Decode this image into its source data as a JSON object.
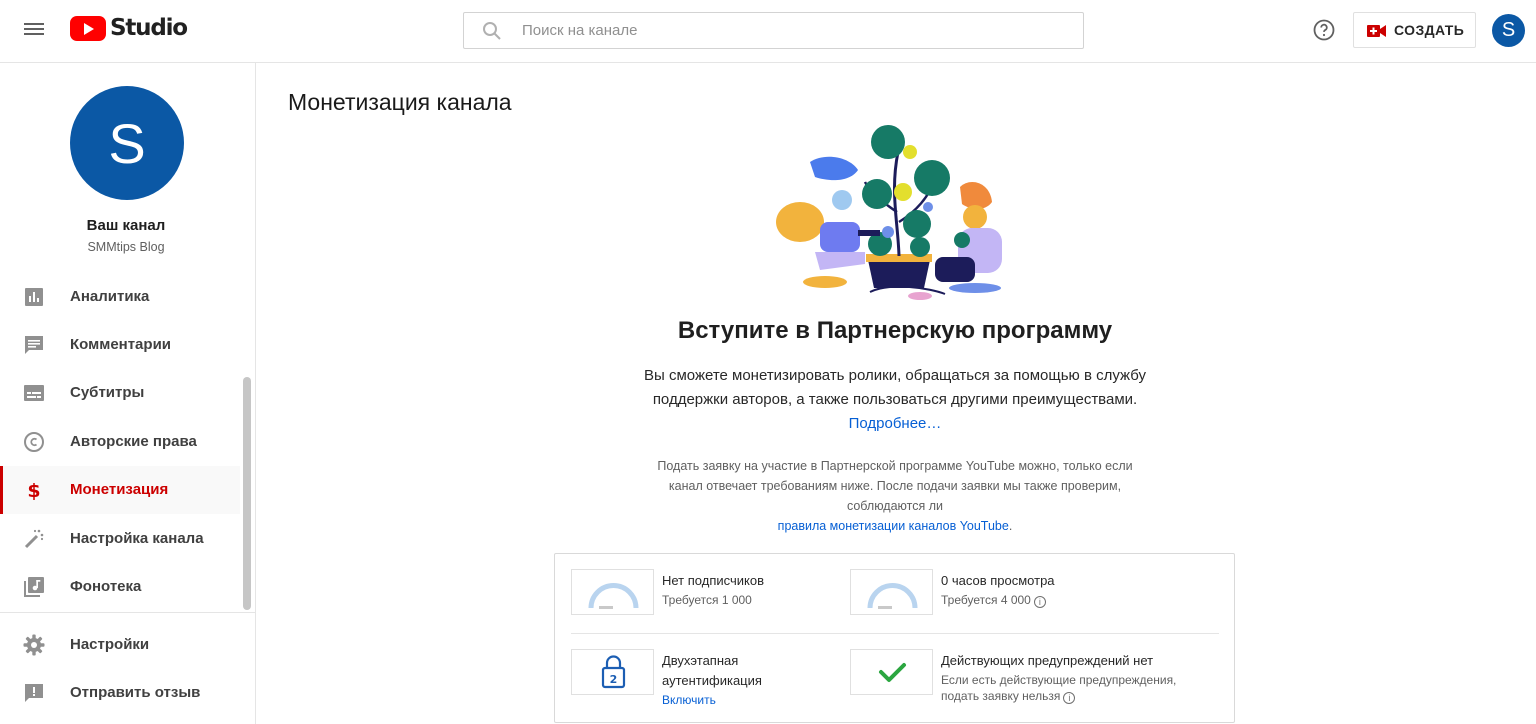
{
  "header": {
    "logo_text": "Studio",
    "search_placeholder": "Поиск на канале",
    "create_label": "СОЗДАТЬ",
    "avatar_letter": "S"
  },
  "sidebar": {
    "avatar_letter": "S",
    "channel_title": "Ваш канал",
    "channel_name": "SMMtips Blog",
    "items": [
      {
        "label": "Аналитика",
        "icon": "analytics-icon"
      },
      {
        "label": "Комментарии",
        "icon": "comments-icon"
      },
      {
        "label": "Субтитры",
        "icon": "subtitles-icon"
      },
      {
        "label": "Авторские права",
        "icon": "copyright-icon"
      },
      {
        "label": "Монетизация",
        "icon": "dollar-icon",
        "active": true
      },
      {
        "label": "Настройка канала",
        "icon": "magic-wand-icon"
      },
      {
        "label": "Фонотека",
        "icon": "music-library-icon"
      },
      {
        "label": "Настройки",
        "icon": "gear-icon"
      },
      {
        "label": "Отправить отзыв",
        "icon": "feedback-icon"
      }
    ]
  },
  "main": {
    "page_title": "Монетизация канала",
    "headline": "Вступите в Партнерскую программу",
    "description": "Вы сможете монетизировать ролики, обращаться за помощью в службу поддержки авторов, а также пользоваться другими преимуществами.",
    "description_link": "Подробнее…",
    "note": "Подать заявку на участие в Партнерской программе YouTube можно, только если канал отвечает требованиям ниже. После подачи заявки мы также проверим, соблюдаются ли",
    "note_link": "правила монетизации каналов YouTube",
    "note_end": ".",
    "requirements": {
      "subscribers": {
        "title": "Нет подписчиков",
        "subtitle": "Требуется 1 000",
        "progress": 0
      },
      "watch_hours": {
        "title": "0 часов просмотра",
        "subtitle": "Требуется 4 000",
        "progress": 0
      },
      "two_step": {
        "title_line1": "Двухэтапная",
        "title_line2": "аутентификация",
        "link": "Включить"
      },
      "strikes": {
        "title": "Действующих предупреждений нет",
        "subtitle_line1": "Если есть действующие предупреждения,",
        "subtitle_line2": "подать заявку нельзя"
      }
    }
  },
  "colors": {
    "accent_red": "#cc0000",
    "link_blue": "#065fd4",
    "avatar_blue": "#0b58a5",
    "gauge_blue": "#b9d4ef",
    "check_green": "#2ba640"
  }
}
